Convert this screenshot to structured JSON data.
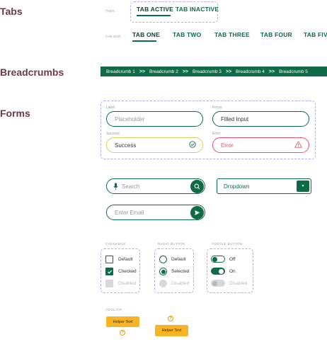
{
  "sections": {
    "tabs": "Tabs",
    "breadcrumbs": "Breadcrumbs",
    "forms": "Forms"
  },
  "tabs_demo": {
    "label": "TABS",
    "active": "TAB ACTIVE",
    "inactive": "TAB INACTIVE"
  },
  "tab_bar": {
    "label": "TAB BAR",
    "items": [
      "TAB ONE",
      "TAB TWO",
      "TAB THREE",
      "TAB FOUR",
      "TAB FIVE"
    ]
  },
  "breadcrumbs": {
    "items": [
      "Breadcrumb 1",
      "Breadcrumb 2",
      "Breadcrumb 3",
      "Breadcrumb 4",
      "Breadcrumb 5"
    ],
    "separator": ">>"
  },
  "forms": {
    "label_text": "Label",
    "placeholder": "Placeholder",
    "focus_label": "Focus",
    "focus_value": "Filled Input",
    "success_label": "Success",
    "success_value": "Success",
    "error_label": "Error",
    "error_value": "Error"
  },
  "search": {
    "placeholder": "Search"
  },
  "dropdown": {
    "value": "Dropdown"
  },
  "email": {
    "placeholder": "Enter Email"
  },
  "checkbox": {
    "label": "CHECKBOX",
    "items": [
      "Default",
      "Checked",
      "Disabled"
    ]
  },
  "radio": {
    "label": "RADIO BUTTON",
    "items": [
      "Default",
      "Selected",
      "Disabled"
    ]
  },
  "toggle": {
    "label": "TOGGLE BUTTON",
    "items": [
      "Off",
      "On",
      "Disabled"
    ]
  },
  "tooltip": {
    "label": "TOOL TIP",
    "text1": "Helper Text",
    "text2": "Helper Text",
    "help_glyph": "?"
  },
  "colors": {
    "primary": "#0f6b46",
    "dashed": "#b7a8f0",
    "error": "#e0566e",
    "success": "#cfd35a",
    "tooltip": "#f7b426",
    "heading": "#6b3a46"
  }
}
